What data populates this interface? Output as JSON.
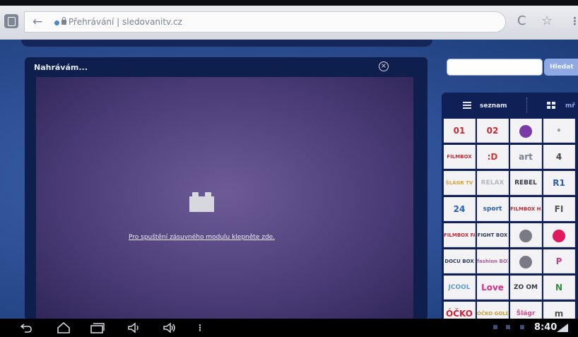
{
  "browser": {
    "url_text": "Přehrávání | sledovanitv.cz",
    "icons": [
      "tab-switcher-icon",
      "back-arrow-icon",
      "globe-icon",
      "padlock-icon",
      "reload-icon",
      "star-icon",
      "menu-icon"
    ]
  },
  "player": {
    "title": "Nahrávám...",
    "plugin_message": "Pro spuštění zásuvného modulu klepněte zde.",
    "icons": [
      "close-icon",
      "plugin-icon"
    ]
  },
  "search": {
    "value": "",
    "button_label": "Hledat"
  },
  "channel_view": {
    "list_label": "seznam",
    "grid_label": "mř"
  },
  "channels": [
    [
      {
        "text": "01",
        "color": "#c62b35"
      },
      {
        "text": "02",
        "color": "#c62b35"
      },
      {
        "text": "",
        "color": "#7b3aa5"
      },
      {
        "text": "•",
        "color": "#a0a0a0"
      }
    ],
    [
      {
        "text": "FILMBOX",
        "color": "#c62b35"
      },
      {
        "text": ":D",
        "color": "#d23a3a"
      },
      {
        "text": "art",
        "color": "#7a8190"
      },
      {
        "text": "4",
        "color": "#444"
      }
    ],
    [
      {
        "text": "ŠLÁGR TV",
        "color": "#e0a23a"
      },
      {
        "text": "RELAX",
        "color": "#b5b8c0"
      },
      {
        "text": "REBEL",
        "color": "#333a44"
      },
      {
        "text": "R1",
        "color": "#2c5fb1"
      }
    ],
    [
      {
        "text": "24",
        "color": "#2461b4"
      },
      {
        "text": "sport",
        "color": "#2c5fa8"
      },
      {
        "text": "FILMBOX HD",
        "color": "#c62b35"
      },
      {
        "text": "FI",
        "color": "#555"
      }
    ],
    [
      {
        "text": "FILMBOX FAMILY",
        "color": "#c62b35"
      },
      {
        "text": "FIGHT BOX",
        "color": "#2f3b59"
      },
      {
        "text": "",
        "color": "#7a7a86"
      },
      {
        "text": "",
        "color": "#e0195f"
      }
    ],
    [
      {
        "text": "DOCU BOX",
        "color": "#2f3b59"
      },
      {
        "text": "fashion BOX",
        "color": "#a6609a"
      },
      {
        "text": "",
        "color": "#7a7a86"
      },
      {
        "text": "P",
        "color": "#c4428a"
      }
    ],
    [
      {
        "text": "JCOOL",
        "color": "#5c9bd1"
      },
      {
        "text": "Love",
        "color": "#d4308a"
      },
      {
        "text": "ZO OM",
        "color": "#333a44"
      },
      {
        "text": "N",
        "color": "#2f8f3a"
      }
    ],
    [
      {
        "text": "ÓČKO",
        "color": "#d0253a"
      },
      {
        "text": "ÓČKO GOLD",
        "color": "#c5a03a"
      },
      {
        "text": "Šlágr",
        "color": "#d24b8a"
      },
      {
        "text": "m",
        "color": "#555"
      }
    ]
  ],
  "android": {
    "clock": "8:40",
    "icons": [
      "back-icon",
      "home-icon",
      "recent-apps-icon",
      "volume-down-icon",
      "volume-up-icon",
      "overflow-icon",
      "wifi-signal-icon"
    ]
  }
}
